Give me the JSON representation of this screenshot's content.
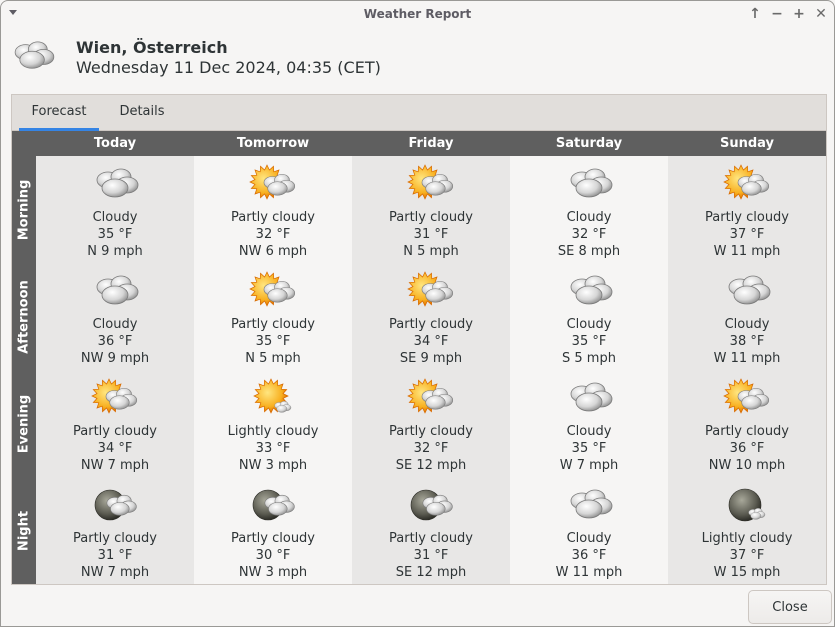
{
  "window": {
    "title": "Weather Report",
    "controls": [
      "above-icon",
      "minimize-icon",
      "maximize-icon",
      "close-icon"
    ]
  },
  "header": {
    "location": "Wien, Österreich",
    "datetime": "Wednesday 11 Dec 2024, 04:35 (CET)",
    "icon": "cloudy-icon"
  },
  "tabs": [
    {
      "label": "Forecast",
      "active": true
    },
    {
      "label": "Details",
      "active": false
    }
  ],
  "forecast": {
    "days": [
      "Today",
      "Tomorrow",
      "Friday",
      "Saturday",
      "Sunday"
    ],
    "periods": [
      "Morning",
      "Afternoon",
      "Evening",
      "Night"
    ],
    "cells": [
      [
        {
          "icon": "cloudy",
          "condition": "Cloudy",
          "temp": "35 °F",
          "wind": "N 9 mph"
        },
        {
          "icon": "cloudy",
          "condition": "Cloudy",
          "temp": "36 °F",
          "wind": "NW 9 mph"
        },
        {
          "icon": "partly-cloudy-day",
          "condition": "Partly cloudy",
          "temp": "34 °F",
          "wind": "NW 7 mph"
        },
        {
          "icon": "partly-cloudy-night",
          "condition": "Partly cloudy",
          "temp": "31 °F",
          "wind": "NW 7 mph"
        }
      ],
      [
        {
          "icon": "partly-cloudy-day",
          "condition": "Partly cloudy",
          "temp": "32 °F",
          "wind": "NW 6 mph"
        },
        {
          "icon": "partly-cloudy-day",
          "condition": "Partly cloudy",
          "temp": "35 °F",
          "wind": "N 5 mph"
        },
        {
          "icon": "lightly-cloudy-day",
          "condition": "Lightly cloudy",
          "temp": "33 °F",
          "wind": "NW 3 mph"
        },
        {
          "icon": "partly-cloudy-night",
          "condition": "Partly cloudy",
          "temp": "30 °F",
          "wind": "NW 3 mph"
        }
      ],
      [
        {
          "icon": "partly-cloudy-day",
          "condition": "Partly cloudy",
          "temp": "31 °F",
          "wind": "N 5 mph"
        },
        {
          "icon": "partly-cloudy-day",
          "condition": "Partly cloudy",
          "temp": "34 °F",
          "wind": "SE 9 mph"
        },
        {
          "icon": "partly-cloudy-day",
          "condition": "Partly cloudy",
          "temp": "32 °F",
          "wind": "SE 12 mph"
        },
        {
          "icon": "partly-cloudy-night",
          "condition": "Partly cloudy",
          "temp": "31 °F",
          "wind": "SE 12 mph"
        }
      ],
      [
        {
          "icon": "cloudy",
          "condition": "Cloudy",
          "temp": "32 °F",
          "wind": "SE 8 mph"
        },
        {
          "icon": "cloudy",
          "condition": "Cloudy",
          "temp": "35 °F",
          "wind": "S 5 mph"
        },
        {
          "icon": "cloudy",
          "condition": "Cloudy",
          "temp": "35 °F",
          "wind": "W 7 mph"
        },
        {
          "icon": "cloudy",
          "condition": "Cloudy",
          "temp": "36 °F",
          "wind": "W 11 mph"
        }
      ],
      [
        {
          "icon": "partly-cloudy-day",
          "condition": "Partly cloudy",
          "temp": "37 °F",
          "wind": "W 11 mph"
        },
        {
          "icon": "cloudy",
          "condition": "Cloudy",
          "temp": "38 °F",
          "wind": "W 11 mph"
        },
        {
          "icon": "partly-cloudy-day",
          "condition": "Partly cloudy",
          "temp": "36 °F",
          "wind": "NW 10 mph"
        },
        {
          "icon": "lightly-cloudy-night",
          "condition": "Lightly cloudy",
          "temp": "37 °F",
          "wind": "W 15 mph"
        }
      ]
    ]
  },
  "buttons": {
    "close": "Close"
  },
  "colors": {
    "accent": "#3584e4",
    "header_bg": "#5f5f5f",
    "col_odd": "#e8e7e6",
    "col_even": "#f6f5f4"
  }
}
